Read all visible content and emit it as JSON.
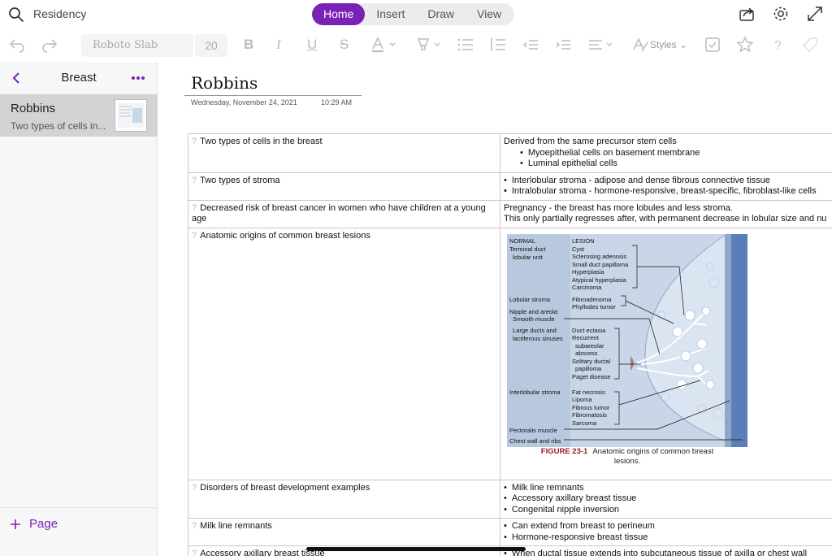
{
  "notebook_title": "Residency",
  "tabs": [
    "Home",
    "Insert",
    "Draw",
    "View"
  ],
  "active_tab": "Home",
  "toolbar": {
    "font_name": "Roboto Slab",
    "font_size": "20",
    "styles_label": "Styles"
  },
  "sidebar": {
    "section_title": "Breast",
    "page": {
      "title": "Robbins",
      "preview": "Two types of cells in..."
    },
    "add_page_label": "Page"
  },
  "page": {
    "title": "Robbins",
    "date": "Wednesday, November 24, 2021",
    "time": "10:29 AM"
  },
  "rows": [
    {
      "q": "Two types of cells in the breast",
      "a_text": "Derived from the same precursor stem cells",
      "a_bullets": [
        "Myoepithelial cells on basement membrane",
        "Luminal epithelial cells"
      ],
      "indent": true
    },
    {
      "q": "Two types of stroma",
      "a_bullets": [
        "Interlobular stroma - adipose and dense fibrous connective tissue",
        "Intralobular stroma - hormone-responsive, breast-specific, fibroblast-like cells"
      ]
    },
    {
      "q": "Decreased risk of breast cancer in women who have children at a young age",
      "a_lines": [
        "Pregnancy - the breast has more lobules and less stroma.",
        "This only partially regresses after, with permanent decrease in lobular size and nu"
      ]
    },
    {
      "q": "Anatomic origins of common breast lesions"
    },
    {
      "q": "Disorders of breast development examples",
      "a_bullets": [
        "Milk line remnants",
        "Accessory axillary breast tissue",
        "Congenital nipple inversion"
      ]
    },
    {
      "q": "Milk line remnants",
      "a_bullets": [
        "Can extend from breast to perineum",
        "Hormone-responsive breast tissue"
      ]
    },
    {
      "q": "Accessory axillary breast tissue",
      "a_bullets": [
        "When ductal tissue extends into subcutaneous tissue of axilla or chest wall"
      ]
    }
  ],
  "figure": {
    "col_normal": "NORMAL",
    "col_lesion": "LESION",
    "left_labels": [
      "Terminal duct",
      "lobular unit",
      "Lobular stroma",
      "Nipple and areola:",
      "Smooth muscle",
      "Large ducts and",
      "lactiferous sinuses",
      "Interlobular stroma",
      "Pectoralis muscle",
      "Chest wall and ribs"
    ],
    "lesions_tdlu": [
      "Cyst",
      "Sclerosing adenosis",
      "Small duct papilloma",
      "Hyperplasia",
      "Atypical hyperplasia",
      "Carcinoma"
    ],
    "lesions_lobular": [
      "Fibroadenoma",
      "Phyllodes tumor"
    ],
    "lesions_ducts": [
      "Duct ectasia",
      "Recurrent",
      "subareolar",
      "abscess",
      "Solitary ductal",
      "papilloma",
      "Paget disease"
    ],
    "lesions_interlobular": [
      "Fat necrosis",
      "Lipoma",
      "Fibrous tumor",
      "Fibromatosis",
      "Sarcoma"
    ],
    "caption_num": "FIGURE 23-1",
    "caption_text": "Anatomic origins of common breast",
    "caption_text2": "lesions."
  },
  "colors": {
    "accent": "#7a22b5"
  }
}
